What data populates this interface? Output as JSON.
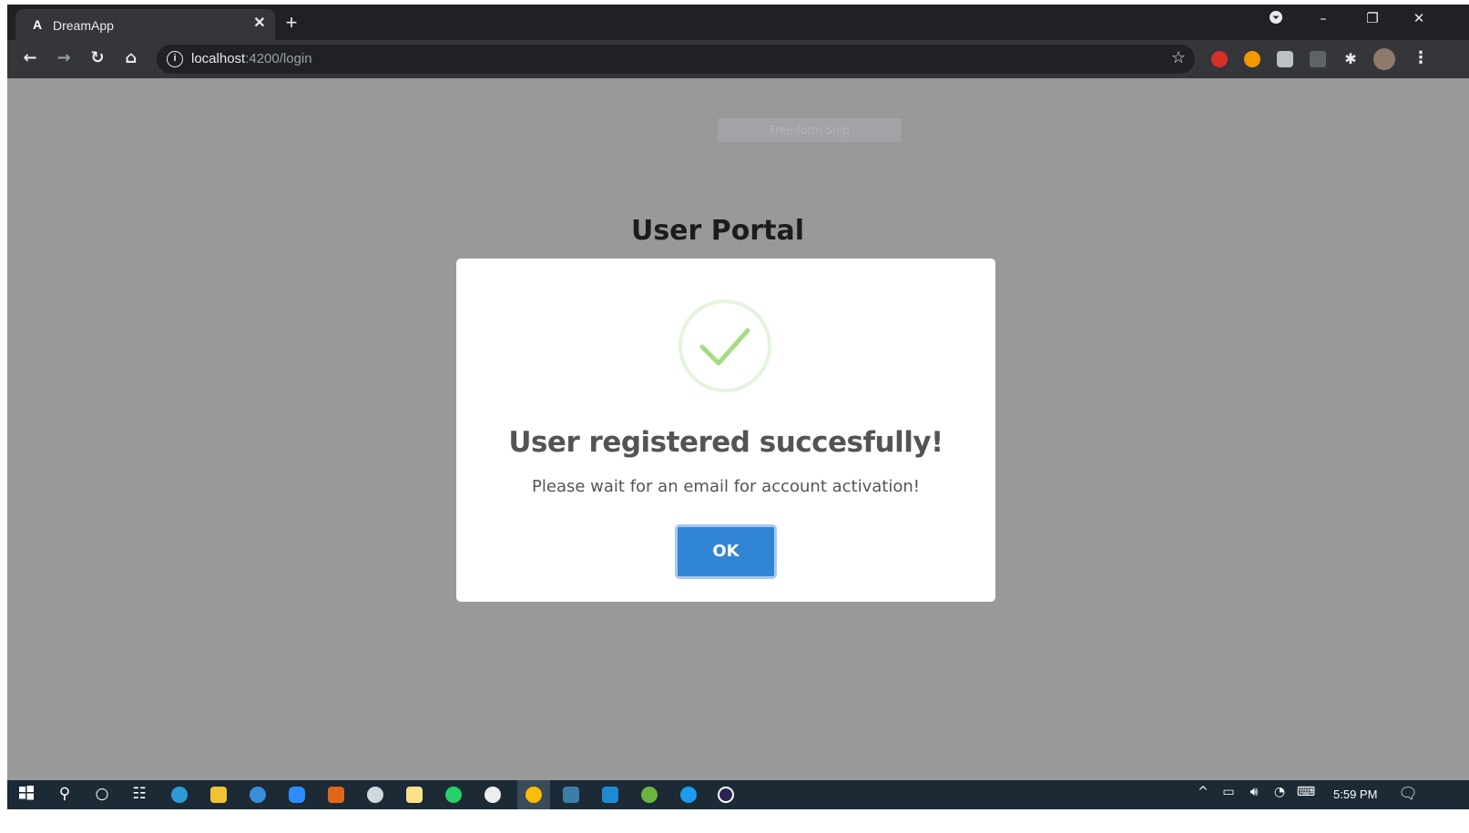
{
  "browser": {
    "tab_title": "DreamApp",
    "tab_favicon_letter": "A",
    "url_host": "localhost",
    "url_rest": ":4200/login"
  },
  "page": {
    "snip_hint": "Free-form Snip",
    "portal_title": "User Portal"
  },
  "modal": {
    "title": "User registered succesfully!",
    "message": "Please wait for an email for account activation!",
    "ok_label": "OK",
    "success_color": "#a5dc86",
    "button_color": "#3085d6"
  },
  "taskbar": {
    "clock": "5:59 PM"
  }
}
